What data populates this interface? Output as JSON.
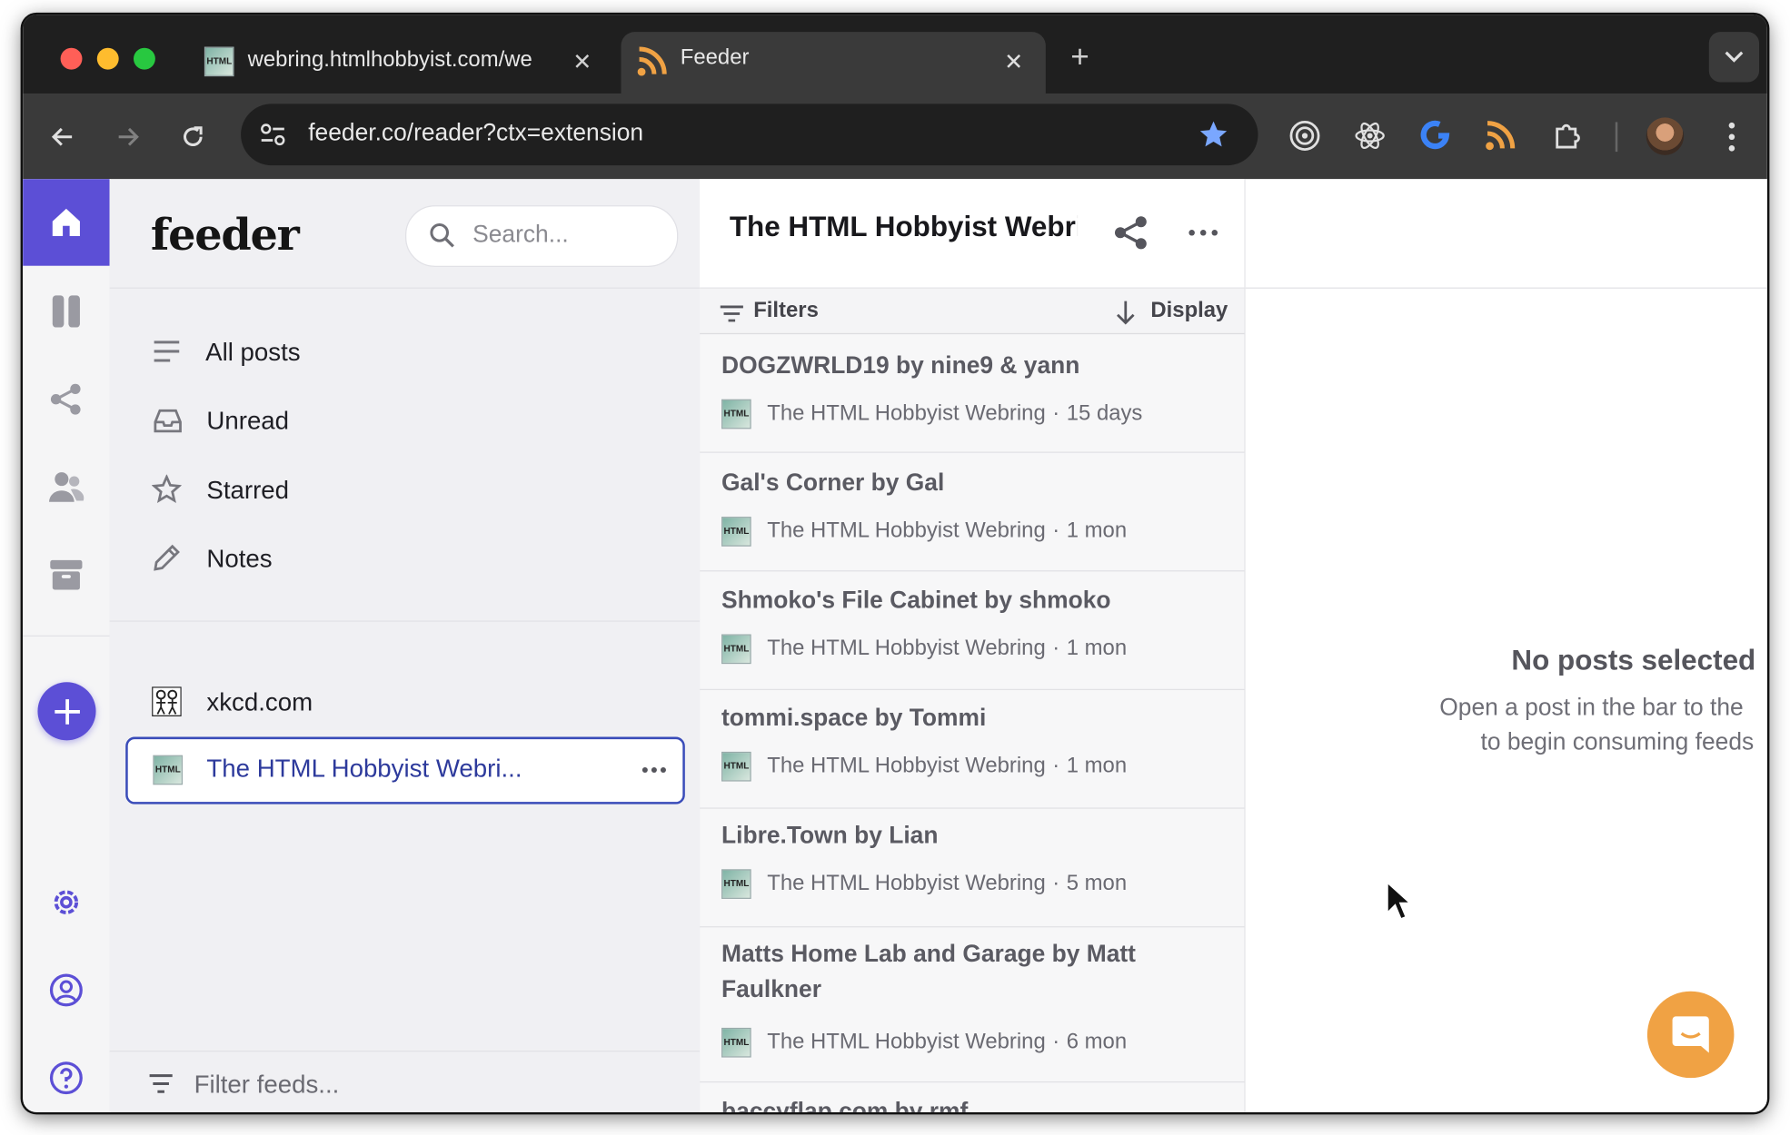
{
  "browser": {
    "tabs": [
      {
        "title": "webring.htmlhobbyist.com/we",
        "active": false
      },
      {
        "title": "Feeder",
        "active": true
      }
    ],
    "url": "feeder.co/reader?ctx=extension"
  },
  "app": {
    "logo": "feeder",
    "search": {
      "placeholder": "Search..."
    },
    "nav": [
      {
        "label": "All posts",
        "icon": "list-icon"
      },
      {
        "label": "Unread",
        "icon": "inbox-icon"
      },
      {
        "label": "Starred",
        "icon": "star-icon"
      },
      {
        "label": "Notes",
        "icon": "pencil-icon"
      }
    ],
    "feeds": [
      {
        "label": "xkcd.com",
        "selected": false
      },
      {
        "label": "The HTML Hobbyist Webri...",
        "selected": true
      }
    ],
    "filter_feeds": {
      "placeholder": "Filter feeds..."
    }
  },
  "list": {
    "title": "The HTML Hobbyist Webrir",
    "filters_label": "Filters",
    "display_label": "Display",
    "posts": [
      {
        "title": "DOGZWRLD19 by nine9 & yann",
        "source": "The HTML Hobbyist Webring",
        "age": "15 days"
      },
      {
        "title": "Gal's Corner by Gal",
        "source": "The HTML Hobbyist Webring",
        "age": "1 mon"
      },
      {
        "title": "Shmoko's File Cabinet by shmoko",
        "source": "The HTML Hobbyist Webring",
        "age": "1 mon"
      },
      {
        "title": "tommi.space by Tommi",
        "source": "The HTML Hobbyist Webring",
        "age": "1 mon"
      },
      {
        "title": "Libre.Town by Lian",
        "source": "The HTML Hobbyist Webring",
        "age": "5 mon"
      },
      {
        "title": "Matts Home Lab and Garage by Matt Faulkner",
        "source": "The HTML Hobbyist Webring",
        "age": "6 mon"
      },
      {
        "title": "baccyflap.com by rmf",
        "source": "",
        "age": ""
      }
    ]
  },
  "detail": {
    "empty_title": "No posts selected",
    "empty_line1": "Open a post in the bar to the",
    "empty_line2": "to begin consuming feeds"
  },
  "colors": {
    "accent": "#5c4fd6",
    "selected_border": "#3a4cb9",
    "chat": "#f0a244",
    "chrome_dark": "#1f1f1f"
  }
}
